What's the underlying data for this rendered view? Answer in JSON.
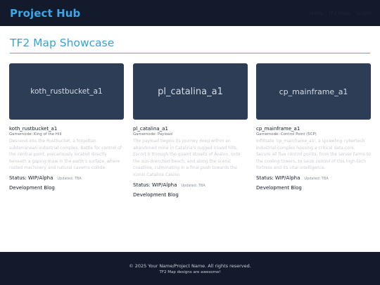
{
  "header": {
    "brand": "Project Hub",
    "nav": [
      "Home",
      "TF2 Maps",
      "Scripts"
    ]
  },
  "page": {
    "title": "TF2 Map Showcase"
  },
  "maps": [
    {
      "thumb_label": "koth_rustbucket_a1",
      "name": "koth_rustbucket_a1",
      "gamemode": "Gamemode: King of the Hill",
      "description": "Descend into the Rustbucket, a forgotten subterranean industrial complex. Battle for control of the central point, precariously located directly beneath a gaping maw in the earth's surface, where rusted machinery and natural caverns collide.",
      "status": "Status: WIP/Alpha",
      "updated": "Updated: TBA",
      "link": "Development Blog"
    },
    {
      "thumb_label": "pl_catalina_a1",
      "name": "pl_catalina_a1",
      "gamemode": "Gamemode: Payload",
      "description": "The payload begins its journey deep within an abandoned mine in Catalina's rugged inland hills. Escort it through the quaint streets of Avalon, onto the sun-drenched beach, and along the scenic coastline, culminating in a final push towards the iconic Catalina Casino.",
      "status": "Status: WIP/Alpha",
      "updated": "Updated: TBA",
      "link": "Development Blog"
    },
    {
      "thumb_label": "cp_mainframe_a1",
      "name": "cp_mainframe_a1",
      "gamemode": "Gamemode: Control Point (5CP)",
      "description": "Infiltrate 'cp_mainframe_a1', a sprawling cybertech industrial complex housing a critical data core. Secure all five control points, from the server farms to the cooling towers, to seize control of this high-tech fortress and its vital intelligence.",
      "status": "Status: WIP/Alpha",
      "updated": "Updated: TBA",
      "link": "Development Blog"
    }
  ],
  "footer": {
    "copyright": "© 2025 Your Name/Project Name. All rights reserved.",
    "tagline": "TF2 Map designs are awesome!"
  }
}
